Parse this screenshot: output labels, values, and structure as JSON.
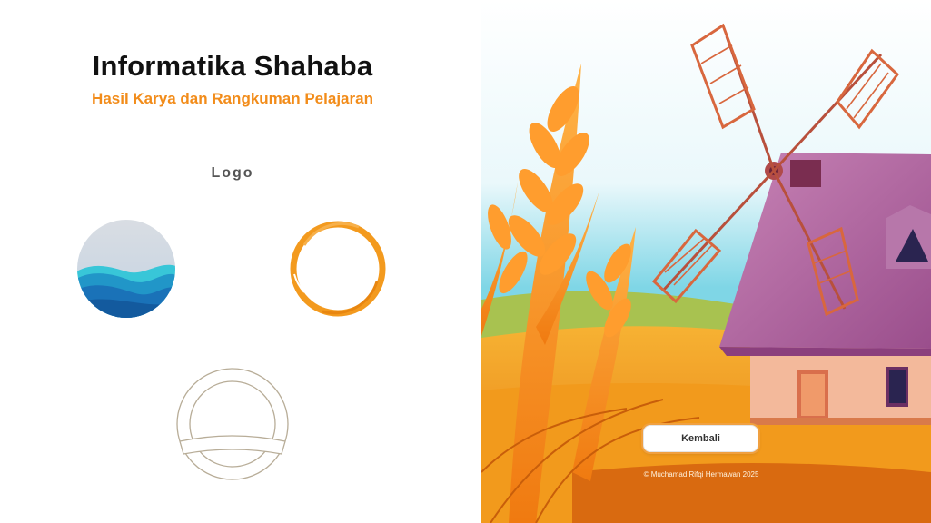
{
  "header": {
    "title": "Informatika Shahaba",
    "subtitle": "Hasil Karya dan Rangkuman Pelajaran"
  },
  "logo_section": {
    "heading": "Logo",
    "items": [
      {
        "icon": "wave-circle-logo-icon"
      },
      {
        "icon": "brush-ring-logo-icon"
      },
      {
        "icon": "outline-ring-logo-icon"
      }
    ]
  },
  "footer": {
    "back_label": "Kembali",
    "copyright": "© Muchamad Rifqi Hermawan 2025"
  },
  "colors": {
    "accent": "#f28c1a",
    "title": "#111111",
    "heading": "#555555"
  }
}
